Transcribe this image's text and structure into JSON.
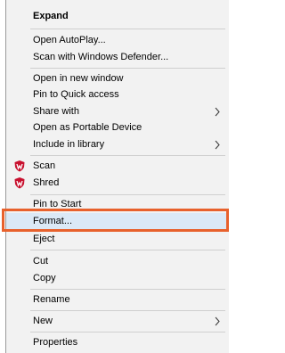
{
  "context_menu": {
    "items": [
      {
        "label": "Expand",
        "bold": true
      },
      {
        "label": "Open AutoPlay..."
      },
      {
        "label": "Scan with Windows Defender..."
      },
      {
        "label": "Open in new window"
      },
      {
        "label": "Pin to Quick access"
      },
      {
        "label": "Share with",
        "submenu": true
      },
      {
        "label": "Open as Portable Device"
      },
      {
        "label": "Include in library",
        "submenu": true
      },
      {
        "label": "Scan",
        "icon": "mcafee-shield-icon"
      },
      {
        "label": "Shred",
        "icon": "mcafee-shield-icon"
      },
      {
        "label": "Pin to Start"
      },
      {
        "label": "Format...",
        "highlighted": true
      },
      {
        "label": "Eject"
      },
      {
        "label": "Cut"
      },
      {
        "label": "Copy"
      },
      {
        "label": "Rename"
      },
      {
        "label": "New",
        "submenu": true
      },
      {
        "label": "Properties"
      }
    ],
    "highlight_color": "#e8612c",
    "icon_color": "#c8102e"
  }
}
